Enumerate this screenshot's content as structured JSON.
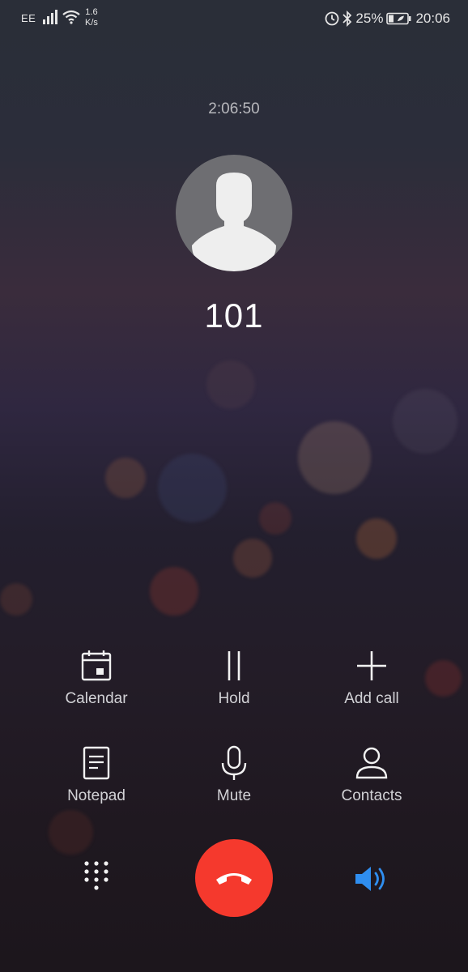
{
  "status_bar": {
    "carrier": "EE",
    "net_speed_value": "1.6",
    "net_speed_unit": "K/s",
    "battery_percent": "25%",
    "time": "20:06"
  },
  "call": {
    "timer": "2:06:50",
    "caller": "101"
  },
  "actions": {
    "calendar": "Calendar",
    "hold": "Hold",
    "add_call": "Add call",
    "notepad": "Notepad",
    "mute": "Mute",
    "contacts": "Contacts"
  },
  "icons": {
    "dialpad": "dialpad-icon",
    "end_call": "end-call-icon",
    "speaker": "speaker-icon"
  },
  "colors": {
    "end_call": "#f5392d",
    "speaker_active": "#2f8ef0"
  }
}
